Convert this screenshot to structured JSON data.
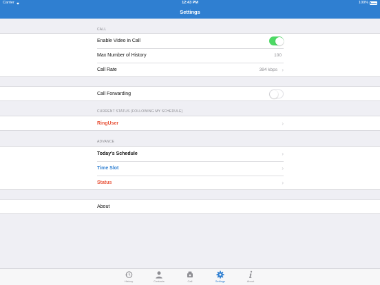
{
  "status_bar": {
    "carrier": "Carrier",
    "time": "12:43 PM",
    "battery": "100%"
  },
  "nav": {
    "title": "Settings"
  },
  "sections": {
    "call": {
      "header": "CALL",
      "enable_video": {
        "label": "Enable Video in Call",
        "on": true
      },
      "max_history": {
        "label": "Max Number of History",
        "value": "100"
      },
      "call_rate": {
        "label": "Call Rate",
        "value": "384 kbps"
      }
    },
    "forwarding": {
      "label": "Call Forwarding",
      "on": false
    },
    "current_status": {
      "header": "CURRENT STATUS (FOLLOWING MY SCHEDULE)",
      "user": "RingUser"
    },
    "advance": {
      "header": "ADVANCE",
      "todays_schedule": "Today's Schedule",
      "time_slot": "Time Slot",
      "status": "Status"
    },
    "about": {
      "label": "About"
    }
  },
  "colors": {
    "accent": "#2f7fd1",
    "red": "#e8543a",
    "blue_text": "#2f7fd1",
    "toggle_on": "#4cd964"
  },
  "tab_bar": {
    "items": [
      {
        "label": "History",
        "icon": "history-icon"
      },
      {
        "label": "Contacts",
        "icon": "contacts-icon"
      },
      {
        "label": "Call",
        "icon": "phone-icon"
      },
      {
        "label": "Settings",
        "icon": "gear-icon",
        "active": true
      },
      {
        "label": "About",
        "icon": "info-icon"
      }
    ]
  }
}
